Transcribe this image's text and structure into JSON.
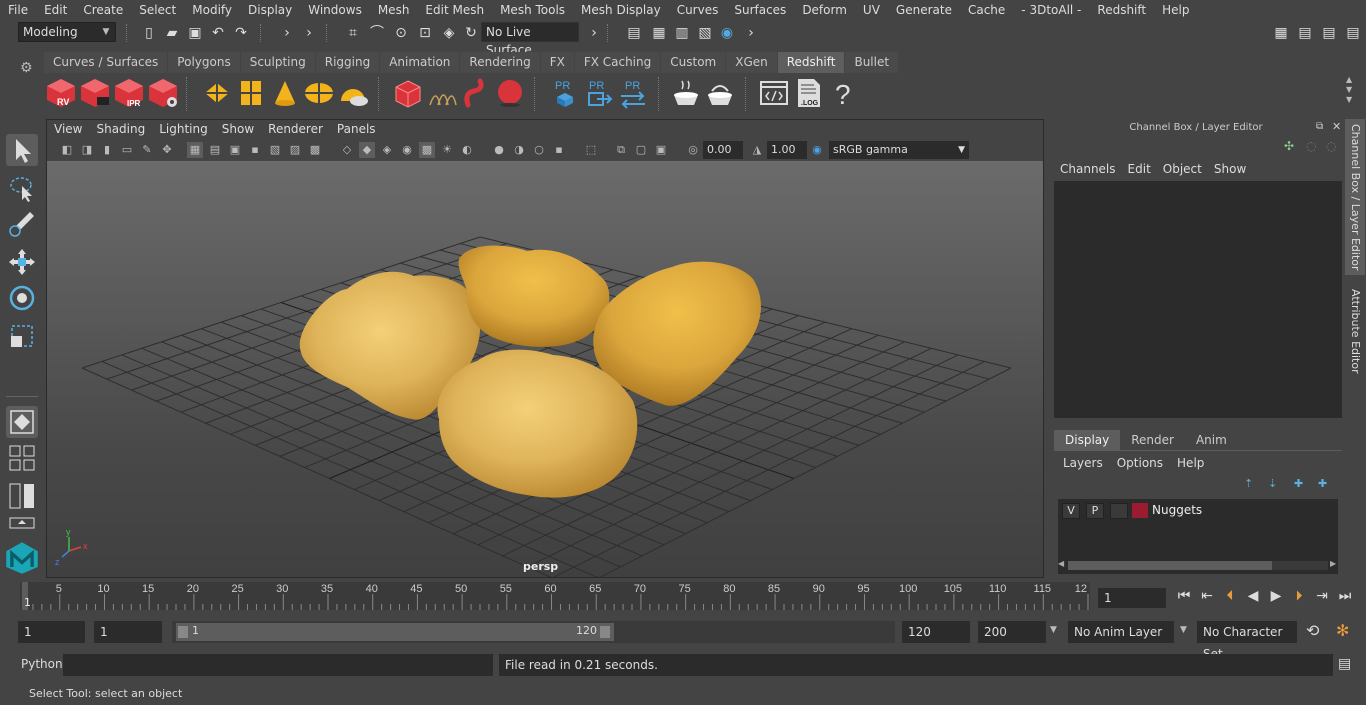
{
  "menubar": {
    "items": [
      "File",
      "Edit",
      "Create",
      "Select",
      "Modify",
      "Display",
      "Windows",
      "Mesh",
      "Edit Mesh",
      "Mesh Tools",
      "Mesh Display",
      "Curves",
      "Surfaces",
      "Deform",
      "UV",
      "Generate",
      "Cache",
      "- 3DtoAll -",
      "Redshift",
      "Help"
    ]
  },
  "statusline": {
    "mode": "Modeling",
    "live_surface": "No Live Surface"
  },
  "shelf": {
    "tabs": [
      "Curves / Surfaces",
      "Polygons",
      "Sculpting",
      "Rigging",
      "Animation",
      "Rendering",
      "FX",
      "FX Caching",
      "Custom",
      "XGen",
      "Redshift",
      "Bullet"
    ],
    "active_tab": "Redshift",
    "icon_labels": {
      "rv": "RV",
      "ipr": "IPR",
      "pr1": "PR",
      "pr2": "PR",
      "pr3": "PR",
      "log": ".LOG",
      "help": "?"
    }
  },
  "viewport": {
    "menu": [
      "View",
      "Shading",
      "Lighting",
      "Show",
      "Renderer",
      "Panels"
    ],
    "exposure": "0.00",
    "gamma": "1.00",
    "colorspace": "sRGB gamma",
    "camera_label": "persp",
    "axis": {
      "x": "x",
      "y": "y",
      "z": "z"
    }
  },
  "channelbox": {
    "title": "Channel Box / Layer Editor",
    "menu": [
      "Channels",
      "Edit",
      "Object",
      "Show"
    ],
    "display_tabs": [
      "Display",
      "Render",
      "Anim"
    ],
    "active_display_tab": "Display",
    "layer_menu": [
      "Layers",
      "Options",
      "Help"
    ],
    "layer": {
      "v": "V",
      "p": "P",
      "name": "Nuggets",
      "color": "#9b1b30"
    }
  },
  "sidetabs": [
    "Channel Box / Layer Editor",
    "Attribute Editor"
  ],
  "timeslider": {
    "ticks": [
      "5",
      "10",
      "15",
      "20",
      "25",
      "30",
      "35",
      "40",
      "45",
      "50",
      "55",
      "60",
      "65",
      "70",
      "75",
      "80",
      "85",
      "90",
      "95",
      "100",
      "105",
      "110",
      "115",
      "12"
    ],
    "start_label": "1",
    "current_frame": "1"
  },
  "range": {
    "start": "1",
    "playback_start": "1",
    "range_start_label": "1",
    "range_end_label": "120",
    "playback_end": "120",
    "end": "200",
    "anim_layer": "No Anim Layer",
    "character_set": "No Character Set"
  },
  "cmdline": {
    "lang": "Python",
    "result": "File read in  0.21 seconds."
  },
  "helpline": {
    "text": "Select Tool: select an object"
  },
  "colors": {
    "ui_bg": "#444444",
    "field_bg": "#2b2b2b",
    "accent": "#5d5d5d",
    "redshift_red": "#d9333b",
    "nugget": "#d9a640"
  }
}
